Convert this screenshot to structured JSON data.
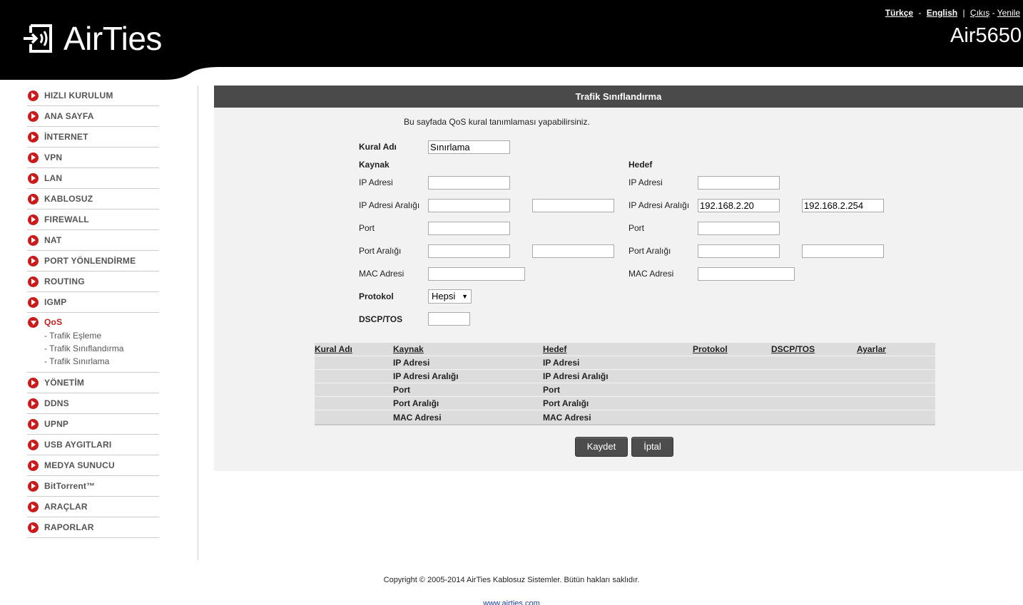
{
  "header": {
    "brand": "AirTies",
    "model": "Air5650",
    "links": {
      "turkish": "Türkçe",
      "sep1": "-",
      "english": "English",
      "sep2": "|",
      "logout": "Çıkış",
      "sep3": "-",
      "refresh": "Yenile"
    }
  },
  "sidebar": {
    "items_top": [
      {
        "label": "HIZLI KURULUM"
      },
      {
        "label": "ANA SAYFA"
      },
      {
        "label": "İNTERNET"
      },
      {
        "label": "VPN"
      },
      {
        "label": "LAN"
      },
      {
        "label": "KABLOSUZ"
      },
      {
        "label": "FIREWALL"
      },
      {
        "label": "NAT"
      },
      {
        "label": "PORT YÖNLENDİRME"
      },
      {
        "label": "ROUTING"
      },
      {
        "label": "IGMP"
      }
    ],
    "qos": {
      "label": "QoS",
      "subitems": [
        "- Trafik Eşleme",
        "- Trafik Sınıflandırma",
        "- Trafik Sınırlama"
      ]
    },
    "items_bottom": [
      {
        "label": "YÖNETİM"
      },
      {
        "label": "DDNS"
      },
      {
        "label": "UPNP"
      },
      {
        "label": "USB AYGITLARI"
      },
      {
        "label": "MEDYA SUNUCU"
      },
      {
        "label": "BitTorrent™"
      },
      {
        "label": "ARAÇLAR"
      },
      {
        "label": "RAPORLAR"
      }
    ]
  },
  "main": {
    "title": "Trafik Sınıflandırma",
    "intro": "Bu sayfada QoS kural tanımlaması yapabilirsiniz.",
    "form": {
      "rule_name_label": "Kural Adı",
      "rule_name_value": "Sınırlama",
      "source_label": "Kaynak",
      "dest_label": "Hedef",
      "ip_label": "IP Adresi",
      "ip_range_label": "IP Adresi Aralığı",
      "port_label": "Port",
      "port_range_label": "Port Aralığı",
      "mac_label": "MAC Adresi",
      "protocol_label": "Protokol",
      "protocol_value": "Hepsi",
      "dscp_label": "DSCP/TOS",
      "source": {
        "ip": "",
        "ip_from": "",
        "ip_to": "",
        "port": "",
        "port_from": "",
        "port_to": "",
        "mac": ""
      },
      "dest": {
        "ip": "",
        "ip_from": "192.168.2.20",
        "ip_to": "192.168.2.254",
        "port": "",
        "port_from": "",
        "port_to": "",
        "mac": ""
      },
      "dscp_value": ""
    },
    "table": {
      "headers": [
        "Kural Adı",
        "Kaynak",
        "Hedef",
        "Protokol",
        "DSCP/TOS",
        "Ayarlar"
      ],
      "rows": [
        [
          "",
          "IP Adresi",
          "IP Adresi",
          "",
          "",
          ""
        ],
        [
          "",
          "IP Adresi Aralığı",
          "IP Adresi Aralığı",
          "",
          "",
          ""
        ],
        [
          "",
          "Port",
          "Port",
          "",
          "",
          ""
        ],
        [
          "",
          "Port Aralığı",
          "Port Aralığı",
          "",
          "",
          ""
        ],
        [
          "",
          "MAC Adresi",
          "MAC Adresi",
          "",
          "",
          ""
        ]
      ]
    },
    "buttons": {
      "save": "Kaydet",
      "cancel": "İptal"
    }
  },
  "footer": {
    "copyright": "Copyright © 2005-2014 AirTies Kablosuz Sistemler. Bütün hakları saklıdır.",
    "link": "www.airties.com"
  }
}
